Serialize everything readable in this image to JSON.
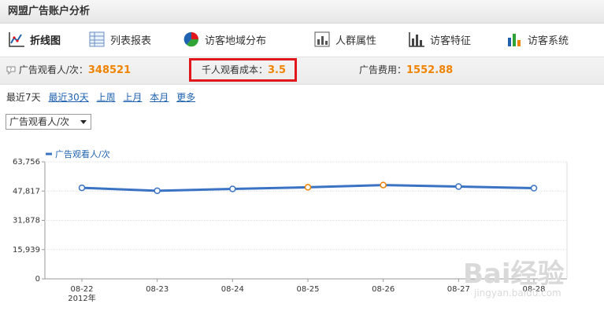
{
  "header": {
    "title": "网盟广告账户分析"
  },
  "tabs": [
    {
      "label": "折线图",
      "icon": "line-chart-icon",
      "active": true
    },
    {
      "label": "列表报表",
      "icon": "table-icon",
      "active": false
    },
    {
      "label": "访客地域分布",
      "icon": "pie-chart-icon",
      "active": false
    },
    {
      "label": "人群属性",
      "icon": "bar-report-icon",
      "active": false
    },
    {
      "label": "访客特征",
      "icon": "bar-chart-icon",
      "active": false
    },
    {
      "label": "访客系统",
      "icon": "color-bars-icon",
      "active": false
    }
  ],
  "stats": {
    "views_label": "广告观看人/次：",
    "views_value": "348521",
    "cpm_label": "千人观看成本：",
    "cpm_value": "3.5",
    "cost_label": "广告费用：",
    "cost_value": "1552.88"
  },
  "ranges": {
    "current": "最近7天",
    "links": [
      "最近30天",
      "上周",
      "上月",
      "本月",
      "更多"
    ]
  },
  "metric_select": {
    "value": "广告观看人/次"
  },
  "colors": {
    "accent": "#f08300",
    "link": "#1e62b0",
    "line": "#3b73c4",
    "highlight": "#e0171b"
  },
  "watermark": {
    "brand": "Bai经验",
    "url": "jingyan.baidu.com"
  },
  "chart_data": {
    "type": "line",
    "legend": "广告观看人/次",
    "categories": [
      "08-22",
      "08-23",
      "08-24",
      "08-25",
      "08-26",
      "08-27",
      "08-28"
    ],
    "year_label": "2012年",
    "series": [
      {
        "name": "广告观看人/次",
        "values": [
          49600,
          48000,
          49000,
          49900,
          51100,
          50300,
          49400
        ]
      }
    ],
    "y_ticks": [
      "63,756",
      "47,817",
      "31,878",
      "15,939",
      "0"
    ],
    "ylim": [
      0,
      63756
    ],
    "highlighted_points": [
      3,
      4
    ]
  }
}
